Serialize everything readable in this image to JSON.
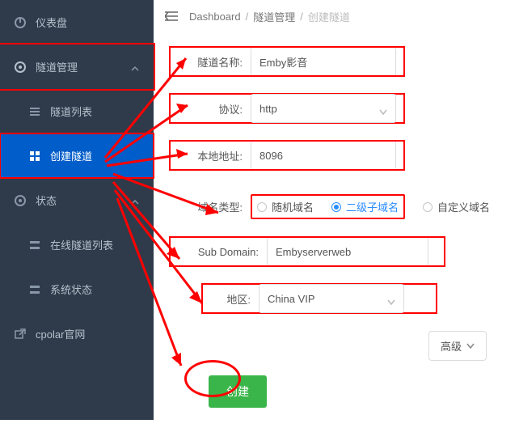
{
  "sidebar": {
    "items": [
      {
        "label": "仪表盘",
        "icon": "dashboard-icon",
        "expandable": false
      },
      {
        "label": "隧道管理",
        "icon": "target-icon",
        "expandable": true
      },
      {
        "label": "隧道列表",
        "icon": "list-icon",
        "sub": true
      },
      {
        "label": "创建隧道",
        "icon": "grid-icon",
        "sub": true
      },
      {
        "label": "状态",
        "icon": "target-icon",
        "expandable": true
      },
      {
        "label": "在线隧道列表",
        "icon": "grid-icon",
        "sub": true
      },
      {
        "label": "系统状态",
        "icon": "grid-icon",
        "sub": true
      },
      {
        "label": "cpolar官网",
        "icon": "external-icon",
        "expandable": false
      }
    ]
  },
  "breadcrumb": {
    "a": "Dashboard",
    "b": "隧道管理",
    "c": "创建隧道"
  },
  "form": {
    "name_label": "隧道名称:",
    "name_value": "Emby影音",
    "proto_label": "协议:",
    "proto_value": "http",
    "local_label": "本地地址:",
    "local_value": "8096",
    "domain_type_label": "域名类型:",
    "domain_type_options": {
      "random": "随机域名",
      "sub": "二级子域名",
      "custom": "自定义域名"
    },
    "domain_type_selected": "sub",
    "subdomain_label": "Sub Domain:",
    "subdomain_value": "Embyserverweb",
    "region_label": "地区:",
    "region_value": "China VIP",
    "advanced_label": "高级",
    "submit_label": "创建"
  }
}
